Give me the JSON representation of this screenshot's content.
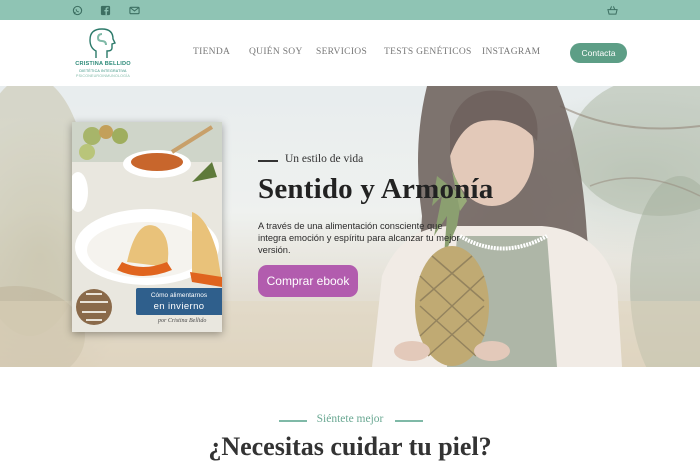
{
  "topbar": {
    "icons": [
      "whatsapp-icon",
      "facebook-icon",
      "mail-icon",
      "shopping-basket-icon"
    ],
    "background": "#8fc4b4"
  },
  "header": {
    "logo": {
      "name": "CRISTINA BELLIDO",
      "line1": "DIETÉTICA INTEGRATIVA",
      "line2": "PSICONEUROINMUNOLOGÍA"
    },
    "nav": [
      "TIENDA",
      "QUIÉN SOY",
      "SERVICIOS",
      "TESTS GENÉTICOS",
      "INSTAGRAM"
    ],
    "contact_label": "Contacta"
  },
  "hero": {
    "ebook": {
      "banner_line1": "Cómo alimentarnos",
      "banner_line2": "en invierno",
      "signature": "por Cristina Bellido"
    },
    "kicker": "Un estilo de vida",
    "title": "Sentido y Armonía",
    "text": "A través de una alimentación consciente que integra emoción y espíritu para alcanzar tu mejor versión.",
    "cta_label": "Comprar ebook"
  },
  "section": {
    "kicker": "Siéntete mejor",
    "title": "¿Necesitas cuidar tu piel?"
  },
  "colors": {
    "accent_green": "#5d9e86",
    "cta_purple": "#b25cae",
    "ebook_blue": "#2f5f8c"
  }
}
